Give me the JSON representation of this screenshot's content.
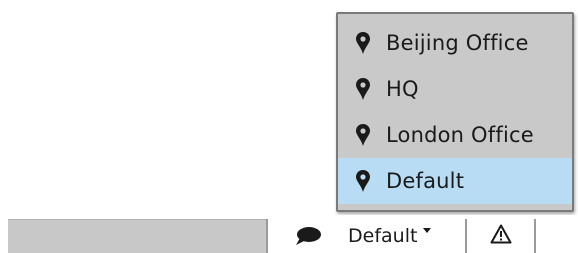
{
  "location_menu": {
    "items": [
      {
        "label": "Beijing Office",
        "icon": "map-pin-icon",
        "selected": false
      },
      {
        "label": "HQ",
        "icon": "map-pin-icon",
        "selected": false
      },
      {
        "label": "London Office",
        "icon": "map-pin-icon",
        "selected": false
      },
      {
        "label": "Default",
        "icon": "map-pin-icon",
        "selected": true
      }
    ],
    "selected_background": "#b8dcf4",
    "menu_background": "#c9c9c9"
  },
  "statusbar": {
    "location_label": "Default",
    "chat_icon": "chat-bubble-icon",
    "warning_icon": "warning-triangle-icon"
  }
}
